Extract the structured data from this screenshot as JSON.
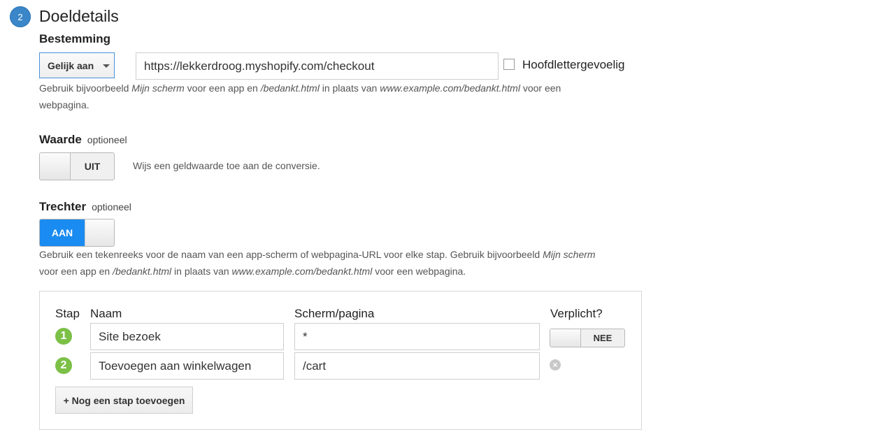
{
  "header": {
    "step_number": "2",
    "title": "Doeldetails"
  },
  "destination": {
    "label": "Bestemming",
    "match_type": "Gelijk aan",
    "value": "https://lekkerdroog.myshopify.com/checkout",
    "case_sensitive_label": "Hoofdlettergevoelig",
    "case_sensitive_checked": false,
    "hint_1": "Gebruik bijvoorbeeld ",
    "hint_em_1": "Mijn scherm",
    "hint_2": " voor een app en ",
    "hint_em_2": "/bedankt.html",
    "hint_3": " in plaats van ",
    "hint_em_3": "www.example.com/bedankt.html",
    "hint_4": " voor een",
    "hint_5": "webpagina."
  },
  "value_section": {
    "label": "Waarde",
    "optional": "optioneel",
    "toggle_text": "UIT",
    "toggle_on": false,
    "description": "Wijs een geldwaarde toe aan de conversie."
  },
  "funnel": {
    "label": "Trechter",
    "optional": "optioneel",
    "toggle_text": "AAN",
    "toggle_on": true,
    "hint_line1_a": "Gebruik een tekenreeks voor de naam van een app-scherm of webpagina-URL voor elke stap. Gebruik bijvoorbeeld ",
    "hint_line1_em": "Mijn scherm",
    "hint_line2_a": "voor een app en ",
    "hint_line2_em1": "/bedankt.html",
    "hint_line2_b": " in plaats van ",
    "hint_line2_em2": "www.example.com/bedankt.html",
    "hint_line2_c": " voor een webpagina.",
    "columns": {
      "step": "Stap",
      "name": "Naam",
      "screen": "Scherm/pagina",
      "required": "Verplicht?"
    },
    "steps": [
      {
        "number": "1",
        "name": "Site bezoek",
        "screen": "*"
      },
      {
        "number": "2",
        "name": "Toevoegen aan winkelwagen",
        "screen": "/cart"
      }
    ],
    "required_toggle_text": "NEE",
    "required_on": false,
    "add_step_label": "+ Nog een stap toevoegen"
  }
}
